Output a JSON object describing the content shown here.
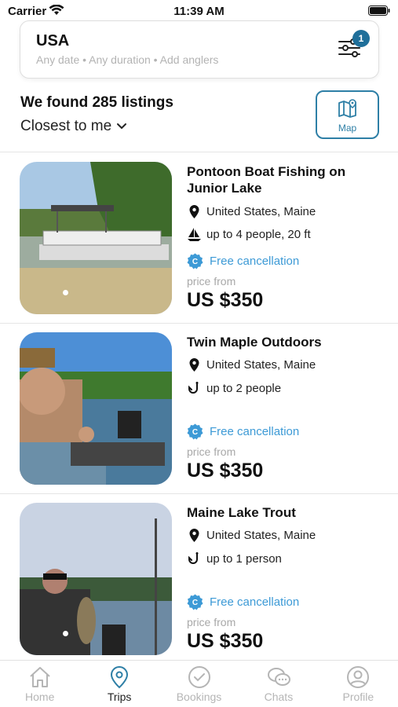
{
  "status": {
    "carrier": "Carrier",
    "time": "11:39 AM"
  },
  "search": {
    "location": "USA",
    "subtitle": "Any date • Any duration • Add anglers",
    "filter_badge": "1"
  },
  "results": {
    "count_text": "We found 285 listings",
    "sort_label": "Closest to me",
    "map_label": "Map"
  },
  "listings": [
    {
      "title": "Pontoon Boat Fishing on Junior Lake",
      "location": "United States, Maine",
      "capacity": "up to 4 people, 20 ft",
      "capacity_icon": "sailboat-icon",
      "cancellation": "Free cancellation",
      "price_from": "price from",
      "price": "US $350"
    },
    {
      "title": "Twin Maple Outdoors",
      "location": "United States, Maine",
      "capacity": "up to 2 people",
      "capacity_icon": "fishing-hook-icon",
      "cancellation": "Free cancellation",
      "price_from": "price from",
      "price": "US $350"
    },
    {
      "title": "Maine Lake Trout",
      "location": "United States, Maine",
      "capacity": "up to 1 person",
      "capacity_icon": "fishing-hook-icon",
      "cancellation": "Free cancellation",
      "price_from": "price from",
      "price": "US $350"
    }
  ],
  "tabs": [
    {
      "label": "Home",
      "icon": "home-icon",
      "active": false
    },
    {
      "label": "Trips",
      "icon": "location-pin-icon",
      "active": true
    },
    {
      "label": "Bookings",
      "icon": "check-circle-icon",
      "active": false
    },
    {
      "label": "Chats",
      "icon": "chat-bubbles-icon",
      "active": false
    },
    {
      "label": "Profile",
      "icon": "user-circle-icon",
      "active": false
    }
  ],
  "colors": {
    "accent": "#2e7fa6",
    "badge": "#1f6f9a",
    "free_cancel": "#3d9ad6",
    "inactive_tab": "#b5b5b5"
  }
}
